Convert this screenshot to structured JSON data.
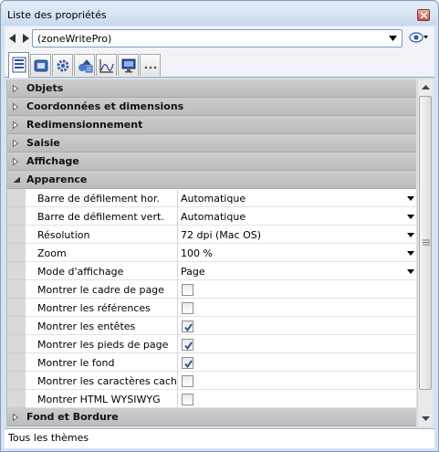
{
  "window": {
    "title": "Liste des propriétés"
  },
  "toolbar": {
    "object_name": "(zoneWritePro)"
  },
  "tabs": [
    {
      "icon": "property-list-icon",
      "active": true
    },
    {
      "icon": "object-icon",
      "active": false
    },
    {
      "icon": "settings-gear-icon",
      "active": false
    },
    {
      "icon": "shapes-icon",
      "active": false
    },
    {
      "icon": "chart-icon",
      "active": false
    },
    {
      "icon": "monitor-icon",
      "active": false
    },
    {
      "icon": "more-icon",
      "active": false
    }
  ],
  "categories": {
    "objets": "Objets",
    "coordonnees": "Coordonnées et dimensions",
    "redimensionnement": "Redimensionnement",
    "saisie": "Saisie",
    "affichage": "Affichage",
    "apparence": "Apparence",
    "fond": "Fond et Bordure"
  },
  "properties": {
    "barre_hor": {
      "name": "Barre de défilement hor.",
      "value": "Automatique"
    },
    "barre_vert": {
      "name": "Barre de défilement vert.",
      "value": "Automatique"
    },
    "resolution": {
      "name": "Résolution",
      "value": "72 dpi (Mac OS)"
    },
    "zoom": {
      "name": "Zoom",
      "value": "100 %"
    },
    "mode": {
      "name": "Mode d'affichage",
      "value": "Page"
    },
    "cadre": {
      "name": "Montrer le cadre de page",
      "checked": false
    },
    "references": {
      "name": "Montrer les références",
      "checked": false
    },
    "entetes": {
      "name": "Montrer les entêtes",
      "checked": true
    },
    "pieds": {
      "name": "Montrer les pieds de page",
      "checked": true
    },
    "fond": {
      "name": "Montrer le fond",
      "checked": true
    },
    "caracteres": {
      "name": "Montrer les caractères cachés",
      "checked": false
    },
    "html": {
      "name": "Montrer HTML WYSIWYG",
      "checked": false
    }
  },
  "status": {
    "text": "Tous les thèmes"
  },
  "colors": {
    "category_bg": "#c4c4c4",
    "check_mark": "#2f4f9e",
    "title_bg": "#c9daef"
  }
}
